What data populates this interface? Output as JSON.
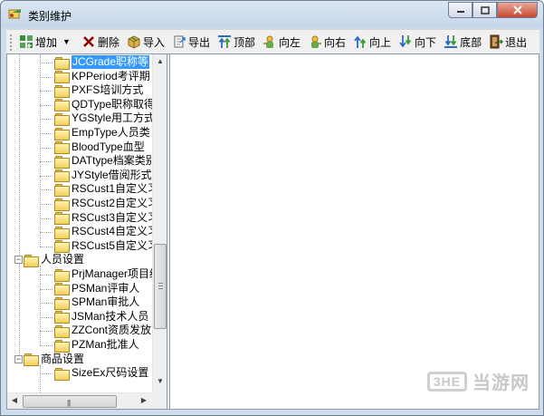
{
  "window": {
    "title": "类别维护",
    "controls": [
      "minimize",
      "maximize",
      "close"
    ]
  },
  "toolbar": {
    "items": [
      {
        "label": "增加",
        "icon": "add-grid-icon",
        "has_dropdown": true
      },
      {
        "label": "删除",
        "icon": "delete-x-icon"
      },
      {
        "label": "导入",
        "icon": "import-box-icon"
      },
      {
        "label": "导出",
        "icon": "export-doc-icon"
      },
      {
        "label": "顶部",
        "icon": "move-top-icon"
      },
      {
        "label": "向左",
        "icon": "move-left-icon"
      },
      {
        "label": "向右",
        "icon": "move-right-icon"
      },
      {
        "label": "向上",
        "icon": "move-up-icon"
      },
      {
        "label": "向下",
        "icon": "move-down-icon"
      },
      {
        "label": "底部",
        "icon": "move-bottom-icon"
      },
      {
        "label": "退出",
        "icon": "exit-door-icon"
      }
    ]
  },
  "tree": {
    "children_a": [
      "JCGrade职称等",
      "KPPeriod考评期",
      "PXFS培训方式",
      "QDType职称取得",
      "YGStyle用工方式",
      "EmpType人员类",
      "BloodType血型",
      "DATtype档案类别",
      "JYStyle借阅形式",
      "RSCust1自定义习",
      "RSCust2自定义习",
      "RSCust3自定义习",
      "RSCust4自定义习",
      "RSCust5自定义习"
    ],
    "group_b": "人员设置",
    "children_b": [
      "PrjManager项目经",
      "PSMan评审人",
      "SPMan审批人",
      "JSMan技术人员",
      "ZZCont资质发放",
      "PZMan批准人"
    ],
    "group_c": "商品设置",
    "children_c": [
      "SizeEx尺码设置"
    ],
    "selected": "JCGrade职称等"
  },
  "watermark": {
    "logo": "3HE",
    "text": "当游网"
  },
  "colors": {
    "selection": "#3399ff",
    "title_bg": "#cfdcea",
    "close_button": "#c7472f"
  }
}
